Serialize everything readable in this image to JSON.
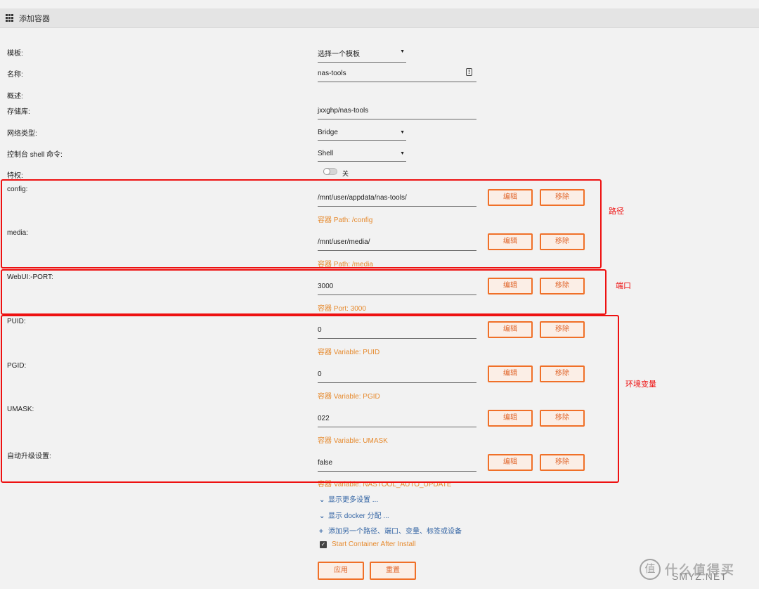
{
  "header": {
    "title": "添加容器",
    "icon": "grid-icon"
  },
  "form": {
    "template": {
      "label": "模板:",
      "value": "选择一个模板"
    },
    "name": {
      "label": "名称:",
      "value": "nas-tools"
    },
    "description": {
      "label": "概述:"
    },
    "repository": {
      "label": "存储库:",
      "value": "jxxghp/nas-tools"
    },
    "network": {
      "label": "网络类型:",
      "value": "Bridge"
    },
    "shell": {
      "label": "控制台 shell 命令:",
      "value": "Shell"
    },
    "privileged": {
      "label": "特权:",
      "state": "关"
    }
  },
  "entries": [
    {
      "label": "config:",
      "value": "/mnt/user/appdata/nas-tools/",
      "hint": "容器 Path: /config"
    },
    {
      "label": "media:",
      "value": "/mnt/user/media/",
      "hint": "容器 Path: /media"
    },
    {
      "label": "WebUI:-PORT:",
      "value": "3000",
      "hint": "容器 Port: 3000"
    },
    {
      "label": "PUID:",
      "value": "0",
      "hint": "容器 Variable: PUID"
    },
    {
      "label": "PGID:",
      "value": "0",
      "hint": "容器 Variable: PGID"
    },
    {
      "label": "UMASK:",
      "value": "022",
      "hint": "容器 Variable: UMASK"
    },
    {
      "label": "自动升级设置:",
      "value": "false",
      "hint": "容器 Variable: NASTOOL_AUTO_UPDATE"
    }
  ],
  "buttons": {
    "edit": "编辑",
    "remove": "移除",
    "apply": "应用",
    "reset": "重置"
  },
  "links": {
    "more_settings": "显示更多设置 ...",
    "docker_alloc": "显示 docker 分配 ...",
    "add_another": "添加另一个路径、端口、变量、标签或设备"
  },
  "checkbox": {
    "label": "Start Container After Install",
    "checked": true
  },
  "annotations": {
    "path": "路径",
    "port": "端口",
    "env": "环境变量"
  },
  "watermark": {
    "text": "什么值得买",
    "sub": "SMYZ.NET"
  },
  "colors": {
    "accent": "#f07028",
    "hint": "#e68a2e",
    "annotation": "#ee1111",
    "link": "#3465a4"
  }
}
